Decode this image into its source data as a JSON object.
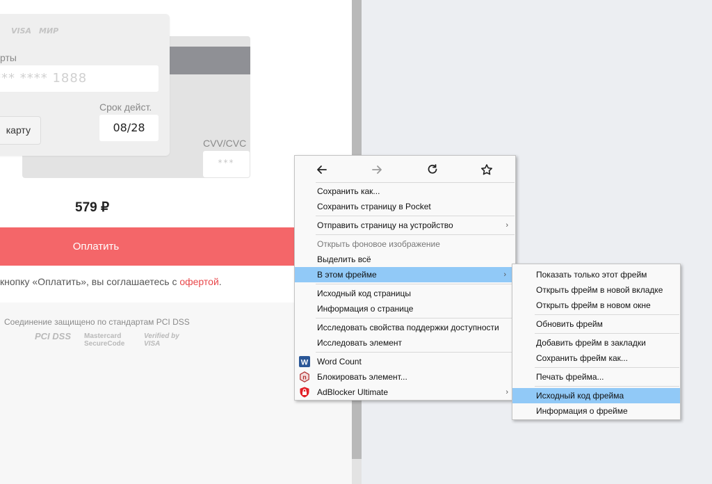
{
  "payment_form": {
    "brand_visa": "VISA",
    "brand_mir": "МИР",
    "card_number_label": "рты",
    "card_number_value": "*** **** 1888",
    "expiry_label": "Срок дейст.",
    "expiry_value": "08/28",
    "cvv_label": "CVV/CVC",
    "cvv_value": "***",
    "card_button": "карту",
    "price": "579 ₽",
    "pay_button": "Оплатить",
    "agreement_text": "кнопку «Оплатить», вы соглашаетесь с ",
    "agreement_link": "офертой",
    "agreement_end": ".",
    "pci_text": "Соединение защищено по стандартам PCI DSS",
    "logo_pci": "PCI DSS",
    "logo_mc_line1": "Mastercard",
    "logo_mc_line2": "SecureCode",
    "logo_visa_line1": "Verified by",
    "logo_visa_line2": "VISA"
  },
  "context_menu": {
    "items": [
      {
        "label": "Сохранить как..."
      },
      {
        "label": "Сохранить страницу в Pocket"
      },
      {
        "label": "Отправить страницу на устройство",
        "submenu": true
      },
      {
        "label": "Открыть фоновое изображение",
        "disabled": true
      },
      {
        "label": "Выделить всё"
      },
      {
        "label": "В этом фрейме",
        "submenu": true,
        "highlighted": true
      },
      {
        "label": "Исходный код страницы"
      },
      {
        "label": "Информация о странице"
      },
      {
        "label": "Исследовать свойства поддержки доступности"
      },
      {
        "label": "Исследовать элемент"
      },
      {
        "label": "Word Count",
        "icon": "word-icon"
      },
      {
        "label": "Блокировать элемент...",
        "icon": "nano-adblock-icon"
      },
      {
        "label": "AdBlocker Ultimate",
        "icon": "adblocker-shield-icon",
        "submenu": true
      }
    ],
    "submenu_arrow": "›"
  },
  "frame_submenu": {
    "items": [
      {
        "label": "Показать только этот фрейм"
      },
      {
        "label": "Открыть фрейм в новой вкладке"
      },
      {
        "label": "Открыть фрейм в новом окне"
      },
      {
        "label": "Обновить фрейм"
      },
      {
        "label": "Добавить фрейм в закладки"
      },
      {
        "label": "Сохранить фрейм как..."
      },
      {
        "label": "Печать фрейма..."
      },
      {
        "label": "Исходный код фрейма",
        "highlighted": true
      },
      {
        "label": "Информация о фрейме"
      }
    ]
  },
  "colors": {
    "pay_button": "#f46669",
    "highlight": "#91c9f7",
    "link": "#e8474a"
  }
}
